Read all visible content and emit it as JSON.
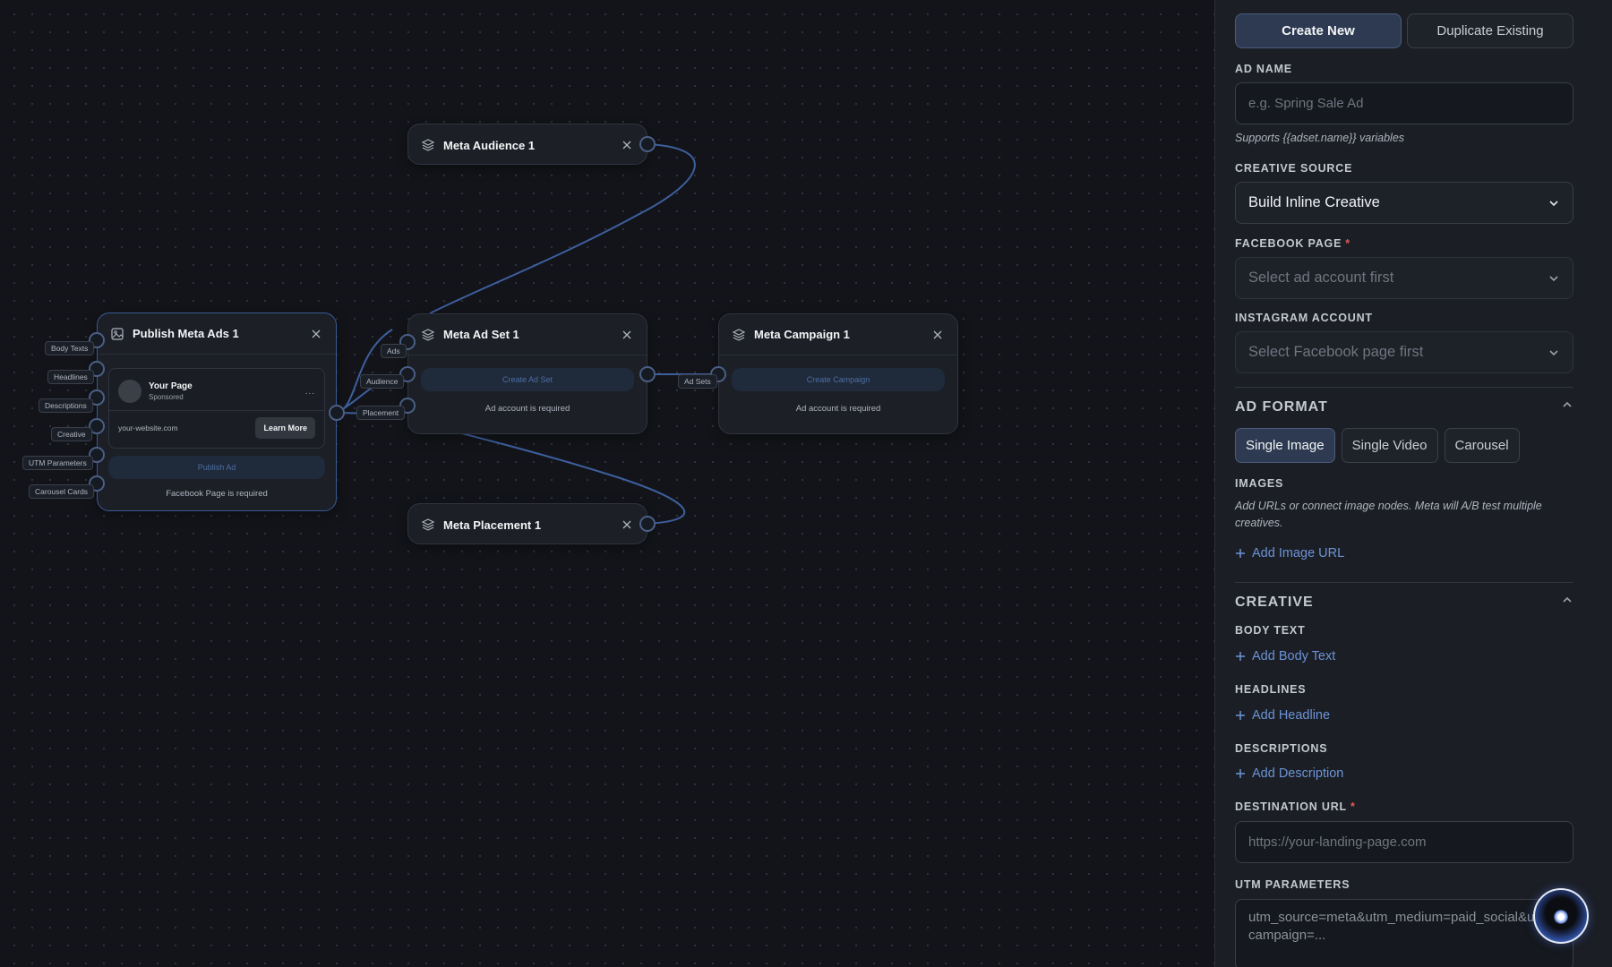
{
  "canvas": {
    "nodes": {
      "audience": {
        "title": "Meta Audience 1"
      },
      "adset": {
        "title": "Meta Ad Set 1",
        "action": "Create Ad Set",
        "hint": "Ad account is required"
      },
      "campaign": {
        "title": "Meta Campaign 1",
        "action": "Create Campaign",
        "hint": "Ad account is required"
      },
      "placement": {
        "title": "Meta Placement 1"
      },
      "publish": {
        "title": "Publish Meta Ads 1",
        "preview": {
          "page_name": "Your Page",
          "sponsored": "Sponsored",
          "more": "...",
          "url": "your-website.com",
          "cta": "Learn More"
        },
        "action": "Publish Ad",
        "hint": "Facebook Page is required"
      }
    },
    "port_labels": {
      "body_texts": "Body Texts",
      "headlines": "Headlines",
      "descriptions": "Descriptions",
      "creative": "Creative",
      "utm_parameters": "UTM Parameters",
      "carousel_cards": "Carousel Cards",
      "ads": "Ads",
      "audience": "Audience",
      "placement": "Placement",
      "ad_sets": "Ad Sets"
    },
    "colors": {
      "edge": "#3e5f9e",
      "handle_border": "#4a5f86",
      "selected_border": "#3b5a96"
    }
  },
  "panel": {
    "mode_tabs": {
      "create_new": "Create New",
      "duplicate_existing": "Duplicate Existing",
      "active": "create_new"
    },
    "ad_name": {
      "label": "AD NAME",
      "placeholder": "e.g. Spring Sale Ad",
      "hint": "Supports {{adset.name}} variables"
    },
    "creative_source": {
      "label": "CREATIVE SOURCE",
      "value": "Build Inline Creative"
    },
    "facebook_page": {
      "label": "FACEBOOK PAGE",
      "required": "*",
      "value": "Select ad account first"
    },
    "instagram_account": {
      "label": "INSTAGRAM ACCOUNT",
      "value": "Select Facebook page first"
    },
    "ad_format": {
      "title": "AD FORMAT",
      "options": {
        "single_image": "Single Image",
        "single_video": "Single Video",
        "carousel": "Carousel"
      },
      "selected": "single_image",
      "images_label": "IMAGES",
      "images_hint": "Add URLs or connect image nodes. Meta will A/B test multiple creatives.",
      "add_image": "Add Image URL"
    },
    "creative": {
      "title": "CREATIVE",
      "body_text_label": "BODY TEXT",
      "add_body_text": "Add Body Text",
      "headlines_label": "HEADLINES",
      "add_headline": "Add Headline",
      "descriptions_label": "DESCRIPTIONS",
      "add_description": "Add Description"
    },
    "destination_url": {
      "label": "DESTINATION URL",
      "required": "*",
      "placeholder": "https://your-landing-page.com"
    },
    "utm_parameters": {
      "label": "UTM PARAMETERS",
      "placeholder": "utm_source=meta&utm_medium=paid_social&utm_campaign=..."
    }
  },
  "icons": {
    "node": "layers-icon",
    "publish": "image-icon",
    "close": "close-icon",
    "chevron": "chevron-down-icon",
    "collapse": "chevron-up-icon",
    "add": "plus-icon",
    "assistant": "assistant-orb-icon"
  }
}
